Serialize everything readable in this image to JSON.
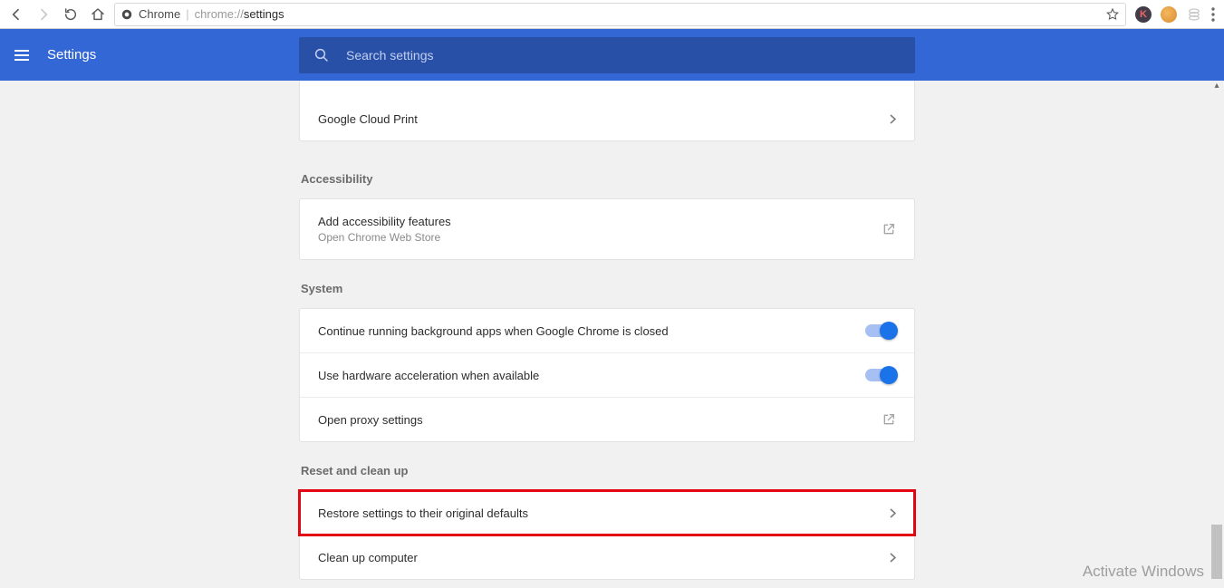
{
  "browser": {
    "origin_label": "Chrome",
    "url_prefix": "chrome://",
    "url_path": "settings"
  },
  "header": {
    "title": "Settings",
    "search_placeholder": "Search settings"
  },
  "sections": {
    "printing": {
      "cloud_print": "Google Cloud Print"
    },
    "accessibility": {
      "title": "Accessibility",
      "add_features": "Add accessibility features",
      "add_features_sub": "Open Chrome Web Store"
    },
    "system": {
      "title": "System",
      "bg_apps": "Continue running background apps when Google Chrome is closed",
      "hw_accel": "Use hardware acceleration when available",
      "proxy": "Open proxy settings"
    },
    "reset": {
      "title": "Reset and clean up",
      "restore": "Restore settings to their original defaults",
      "cleanup": "Clean up computer"
    }
  },
  "watermark": {
    "line1": "Activate Windows"
  }
}
